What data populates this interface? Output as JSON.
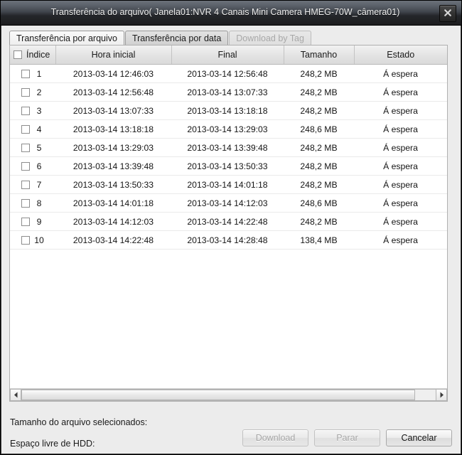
{
  "window": {
    "title": "Transferência do arquivo( Janela01:NVR 4 Canais Mini Camera HMEG-70W_câmera01)",
    "close_label": "close-icon"
  },
  "tabs": [
    {
      "label": "Transferência por arquivo",
      "state": "active"
    },
    {
      "label": "Transferência por data",
      "state": "normal"
    },
    {
      "label": "Download by Tag",
      "state": "disabled"
    }
  ],
  "table": {
    "columns": [
      "Índice",
      "Hora inicial",
      "Final",
      "Tamanho",
      "Estado"
    ],
    "rows": [
      {
        "index": "1",
        "start": "2013-03-14 12:46:03",
        "end": "2013-03-14 12:56:48",
        "size": "248,2 MB",
        "state": "Á espera"
      },
      {
        "index": "2",
        "start": "2013-03-14 12:56:48",
        "end": "2013-03-14 13:07:33",
        "size": "248,2 MB",
        "state": "Á espera"
      },
      {
        "index": "3",
        "start": "2013-03-14 13:07:33",
        "end": "2013-03-14 13:18:18",
        "size": "248,2 MB",
        "state": "Á espera"
      },
      {
        "index": "4",
        "start": "2013-03-14 13:18:18",
        "end": "2013-03-14 13:29:03",
        "size": "248,6 MB",
        "state": "Á espera"
      },
      {
        "index": "5",
        "start": "2013-03-14 13:29:03",
        "end": "2013-03-14 13:39:48",
        "size": "248,2 MB",
        "state": "Á espera"
      },
      {
        "index": "6",
        "start": "2013-03-14 13:39:48",
        "end": "2013-03-14 13:50:33",
        "size": "248,2 MB",
        "state": "Á espera"
      },
      {
        "index": "7",
        "start": "2013-03-14 13:50:33",
        "end": "2013-03-14 14:01:18",
        "size": "248,2 MB",
        "state": "Á espera"
      },
      {
        "index": "8",
        "start": "2013-03-14 14:01:18",
        "end": "2013-03-14 14:12:03",
        "size": "248,6 MB",
        "state": "Á espera"
      },
      {
        "index": "9",
        "start": "2013-03-14 14:12:03",
        "end": "2013-03-14 14:22:48",
        "size": "248,2 MB",
        "state": "Á espera"
      },
      {
        "index": "10",
        "start": "2013-03-14 14:22:48",
        "end": "2013-03-14 14:28:48",
        "size": "138,4 MB",
        "state": "Á espera"
      }
    ]
  },
  "footer": {
    "selected_size_label": "Tamanho do arquivo selecionados:",
    "hdd_free_label": "Espaço livre de HDD:",
    "buttons": [
      {
        "label": "Download",
        "state": "disabled"
      },
      {
        "label": "Parar",
        "state": "disabled"
      },
      {
        "label": "Cancelar",
        "state": "enabled"
      }
    ]
  }
}
